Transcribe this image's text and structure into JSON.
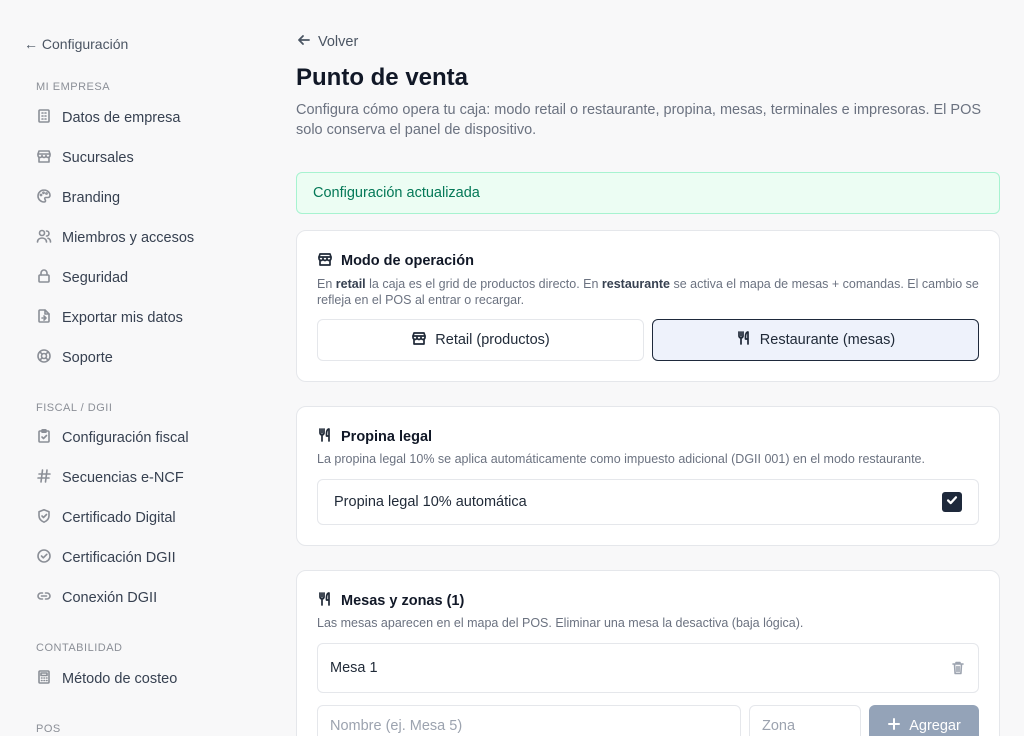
{
  "sidebar": {
    "back_label": "← Configuración",
    "sections": [
      {
        "label": "MI EMPRESA"
      },
      {
        "label": "FISCAL / DGII"
      },
      {
        "label": "CONTABILIDAD"
      },
      {
        "label": "POS"
      }
    ],
    "items": [
      {
        "label": "Datos de empresa",
        "icon": "building-icon"
      },
      {
        "label": "Sucursales",
        "icon": "store-icon"
      },
      {
        "label": "Branding",
        "icon": "palette-icon"
      },
      {
        "label": "Miembros y accesos",
        "icon": "users-icon"
      },
      {
        "label": "Seguridad",
        "icon": "lock-icon"
      },
      {
        "label": "Exportar mis datos",
        "icon": "file-export-icon"
      },
      {
        "label": "Soporte",
        "icon": "lifebuoy-icon"
      },
      {
        "label": "Configuración fiscal",
        "icon": "clipboard-check-icon"
      },
      {
        "label": "Secuencias e-NCF",
        "icon": "hash-icon"
      },
      {
        "label": "Certificado Digital",
        "icon": "shield-check-icon"
      },
      {
        "label": "Certificación DGII",
        "icon": "circle-check-icon"
      },
      {
        "label": "Conexión DGII",
        "icon": "link-icon"
      },
      {
        "label": "Método de costeo",
        "icon": "calculator-icon"
      }
    ]
  },
  "main": {
    "back_label": "Volver",
    "title": "Punto de venta",
    "description": "Configura cómo opera tu caja: modo retail o restaurante, propina, mesas, terminales e impresoras. El POS solo conserva el panel de dispositivo.",
    "alert": "Configuración actualizada"
  },
  "mode_card": {
    "title": "Modo de operación",
    "desc_1": "En ",
    "desc_retail": "retail",
    "desc_2": " la caja es el grid de productos directo. En ",
    "desc_restaurant": "restaurante",
    "desc_3": " se activa el mapa de mesas + comandas. El cambio se refleja en el POS al entrar o recargar.",
    "retail_label": "Retail (productos)",
    "restaurant_label": "Restaurante (mesas)",
    "selected": "restaurante"
  },
  "tip_card": {
    "title": "Propina legal",
    "description": "La propina legal 10% se aplica automáticamente como impuesto adicional (DGII 001) en el modo restaurante.",
    "toggle_label": "Propina legal 10% automática",
    "checked": true
  },
  "tables_card": {
    "title": "Mesas y zonas (1)",
    "description": "Las mesas aparecen en el mapa del POS. Eliminar una mesa la desactiva (baja lógica).",
    "tables": [
      {
        "name": "Mesa 1"
      }
    ],
    "name_placeholder": "Nombre (ej. Mesa 5)",
    "zone_placeholder": "Zona",
    "add_label": "Agregar"
  }
}
